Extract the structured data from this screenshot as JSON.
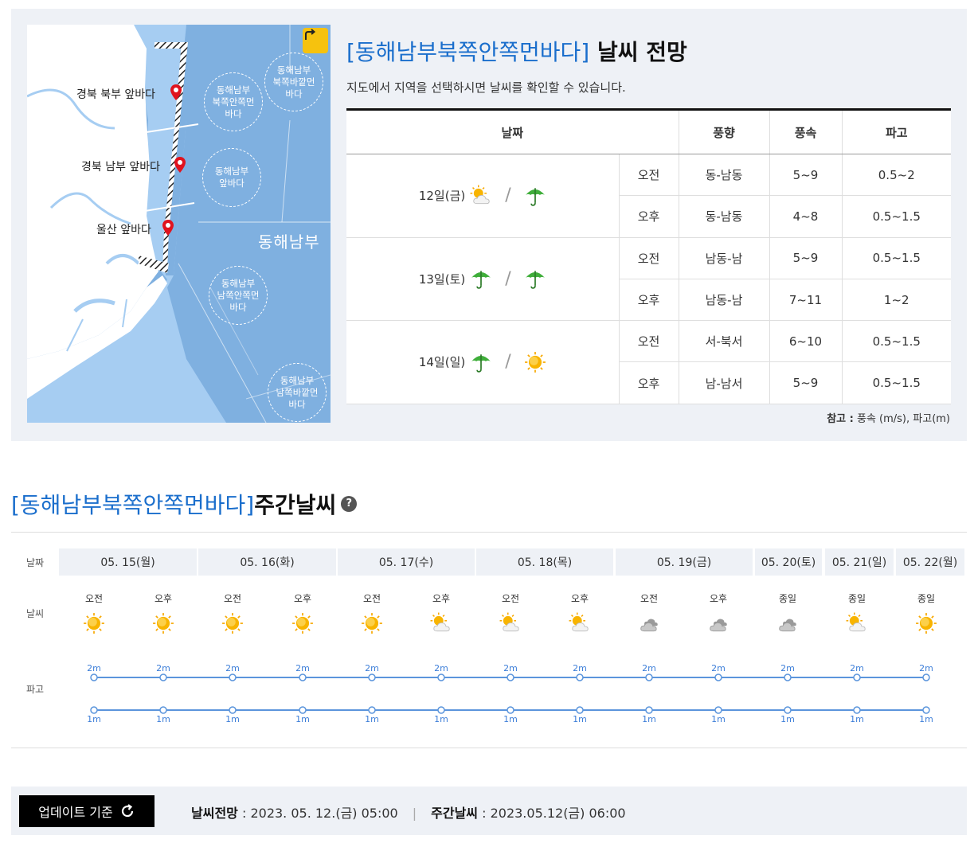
{
  "forecast": {
    "region_bracket": "[동해남부북쪽안쪽먼바다]",
    "title_suffix": " 날씨 전망",
    "subtitle": "지도에서 지역을 선택하시면 날씨를 확인할 수 있습니다.",
    "headers": [
      "날짜",
      "풍향",
      "풍속",
      "파고"
    ],
    "days": [
      {
        "date": "12일(금)",
        "icons": [
          "partly-cloudy-icon",
          "umbrella-icon"
        ],
        "rows": [
          {
            "period": "오전",
            "dir": "동-남동",
            "speed": "5~9",
            "wave": "0.5~2"
          },
          {
            "period": "오후",
            "dir": "동-남동",
            "speed": "4~8",
            "wave": "0.5~1.5"
          }
        ]
      },
      {
        "date": "13일(토)",
        "icons": [
          "umbrella-icon",
          "umbrella-icon"
        ],
        "rows": [
          {
            "period": "오전",
            "dir": "남동-남",
            "speed": "5~9",
            "wave": "0.5~1.5"
          },
          {
            "period": "오후",
            "dir": "남동-남",
            "speed": "7~11",
            "wave": "1~2"
          }
        ]
      },
      {
        "date": "14일(일)",
        "icons": [
          "umbrella-icon",
          "sun-icon"
        ],
        "rows": [
          {
            "period": "오전",
            "dir": "서-북서",
            "speed": "6~10",
            "wave": "0.5~1.5"
          },
          {
            "period": "오후",
            "dir": "남-남서",
            "speed": "5~9",
            "wave": "0.5~1.5"
          }
        ]
      }
    ],
    "note_label": "참고 :",
    "note_text": " 풍속 (m/s), 파고(m)"
  },
  "map": {
    "labels": [
      "경북 북부 앞바다",
      "경북 남부 앞바다",
      "울산 앞바다"
    ],
    "zones": [
      "동해남부\n북쪽안쪽먼\n바다",
      "동해남부\n북쪽바깥먼\n바다",
      "동해남부\n앞바다",
      "동해남부\n남쪽안쪽먼\n바다",
      "동해남부\n남쪽바깥먼\n바다"
    ],
    "region_name": "동해남부"
  },
  "weekly": {
    "region_bracket": "[동해남부북쪽안쪽먼바다]",
    "title_suffix": " 주간날씨",
    "help": "?",
    "row_labels": {
      "date": "날짜",
      "weather": "날씨",
      "wave": "파고"
    },
    "days": [
      "05. 15(월)",
      "05. 16(화)",
      "05. 17(수)",
      "05. 18(목)",
      "05. 19(금)",
      "05. 20(토)",
      "05. 21(일)",
      "05. 22(월)"
    ],
    "slots": [
      {
        "label": "오전",
        "icon": "sun-icon",
        "high": "2m",
        "low": "1m"
      },
      {
        "label": "오후",
        "icon": "sun-icon",
        "high": "2m",
        "low": "1m"
      },
      {
        "label": "오전",
        "icon": "sun-icon",
        "high": "2m",
        "low": "1m"
      },
      {
        "label": "오후",
        "icon": "sun-icon",
        "high": "2m",
        "low": "1m"
      },
      {
        "label": "오전",
        "icon": "sun-icon",
        "high": "2m",
        "low": "1m"
      },
      {
        "label": "오후",
        "icon": "partly-cloudy-icon",
        "high": "2m",
        "low": "1m"
      },
      {
        "label": "오전",
        "icon": "partly-cloudy-icon",
        "high": "2m",
        "low": "1m"
      },
      {
        "label": "오후",
        "icon": "partly-cloudy-icon",
        "high": "2m",
        "low": "1m"
      },
      {
        "label": "오전",
        "icon": "cloudy-icon",
        "high": "2m",
        "low": "1m"
      },
      {
        "label": "오후",
        "icon": "cloudy-icon",
        "high": "2m",
        "low": "1m"
      },
      {
        "label": "종일",
        "icon": "cloudy-icon",
        "high": "2m",
        "low": "1m"
      },
      {
        "label": "종일",
        "icon": "partly-cloudy-icon",
        "high": "2m",
        "low": "1m"
      },
      {
        "label": "종일",
        "icon": "sun-icon",
        "high": "2m",
        "low": "1m"
      }
    ]
  },
  "update": {
    "button_label": "업데이트 기준",
    "forecast_label": "날씨전망",
    "forecast_time": " : 2023. 05. 12.(금) 05:00",
    "separator": "|",
    "weekly_label": "주간날씨",
    "weekly_time": " : 2023.05.12(금) 06:00"
  },
  "colors": {
    "accent_blue": "#1a6ecc",
    "sea": "#7fb0e0",
    "near_sea": "#a6cdf2",
    "land": "#ffffff",
    "sun": "#f7a800",
    "umbrella": "#3fae3a"
  }
}
